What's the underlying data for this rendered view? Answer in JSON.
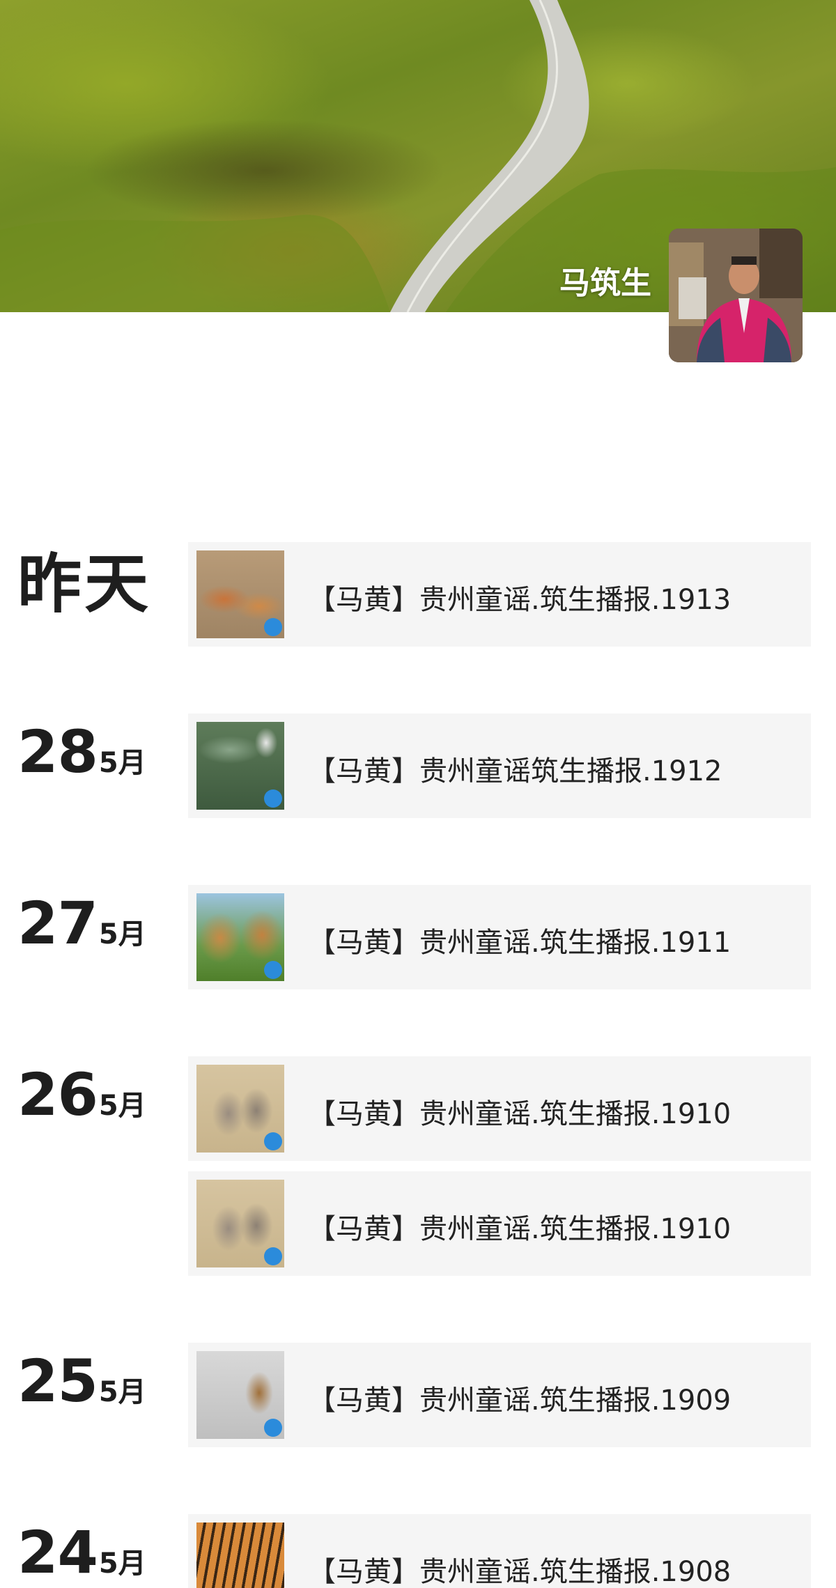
{
  "cover": {
    "name": "马筑生",
    "avatar_icon": "profile-photo",
    "image_icon": "mountain-road-landscape"
  },
  "feed": [
    {
      "date_label": "昨天",
      "month": "",
      "posts": [
        {
          "title": "【马黄】贵州童谣.筑生播报.1913",
          "thumb_icon": "hens-photo"
        }
      ]
    },
    {
      "date_label": "28",
      "month": "5月",
      "posts": [
        {
          "title": "【马黄】贵州童谣筑生播报.1912",
          "thumb_icon": "frog-and-cat-photo"
        }
      ]
    },
    {
      "date_label": "27",
      "month": "5月",
      "posts": [
        {
          "title": "【马黄】贵州童谣.筑生播报.1911",
          "thumb_icon": "lions-photo"
        }
      ]
    },
    {
      "date_label": "26",
      "month": "5月",
      "posts": [
        {
          "title": "【马黄】贵州童谣.筑生播报.1910",
          "thumb_icon": "wolves-photo"
        },
        {
          "title": "【马黄】贵州童谣.筑生播报.1910",
          "thumb_icon": "wolves-photo"
        }
      ]
    },
    {
      "date_label": "25",
      "month": "5月",
      "posts": [
        {
          "title": "【马黄】贵州童谣.筑生播报.1909",
          "thumb_icon": "snow-animal-photo"
        }
      ]
    },
    {
      "date_label": "24",
      "month": "5月",
      "posts": [
        {
          "title": "【马黄】贵州童谣.筑生播报.1908",
          "thumb_icon": "tiger-photo"
        }
      ]
    }
  ]
}
